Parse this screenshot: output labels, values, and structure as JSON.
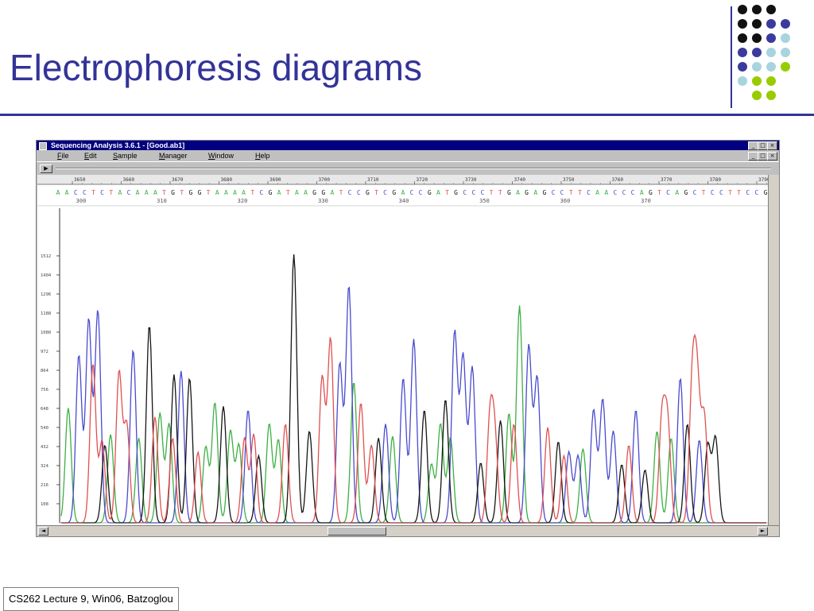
{
  "slide": {
    "title": "Electrophoresis diagrams",
    "footer": "CS262 Lecture 9, Win06, Batzoglou",
    "accent_color": "#333399",
    "dot_colors": {
      "black": "#111111",
      "purple": "#3b3b9e",
      "lightblue": "#a8d4e0",
      "green": "#99cc00"
    },
    "dot_grid": [
      [
        "black",
        "black",
        "black",
        null
      ],
      [
        "black",
        "black",
        "purple",
        "purple"
      ],
      [
        "black",
        "black",
        "purple",
        "lightblue"
      ],
      [
        "purple",
        "purple",
        "lightblue",
        "lightblue"
      ],
      [
        "purple",
        "lightblue",
        "lightblue",
        "green"
      ],
      [
        "lightblue",
        "green",
        "green",
        null
      ],
      [
        null,
        "green",
        "green",
        null
      ]
    ]
  },
  "app": {
    "window_title": "Sequencing Analysis 3.6.1 - [Good.ab1]",
    "menu": [
      "File",
      "Edit",
      "Sample",
      "Manager",
      "Window",
      "Help"
    ],
    "title_buttons": {
      "minimize": "_",
      "maximize": "□",
      "close": "×"
    },
    "tool_button": "▶",
    "scroll_left": "◄",
    "scroll_right": "►"
  },
  "chart_data": {
    "type": "line",
    "title": "",
    "xlabel": "",
    "ylabel": "",
    "sequence": "AACCTCTACAAATGTGGTAAAATCGATAAGGATCCGTCGACCGATGCCCTTGAGAGCCTTCAACCCAGTCAGCTCCTTCCG",
    "base_positions": [
      "300",
      "310",
      "320",
      "330",
      "340",
      "350",
      "360",
      "370"
    ],
    "scan_numbers": [
      "3650",
      "3660",
      "3670",
      "3680",
      "3690",
      "3700",
      "3710",
      "3720",
      "3730",
      "3740",
      "3750",
      "3760",
      "3770",
      "3780",
      "3790"
    ],
    "y_ticks": [
      "1512",
      "1404",
      "1296",
      "1188",
      "1080",
      "972",
      "864",
      "756",
      "648",
      "540",
      "432",
      "324",
      "216",
      "108"
    ],
    "ylim": [
      0,
      1620
    ],
    "series": [
      {
        "name": "A",
        "color": "#3cb043",
        "peaks": [
          {
            "x": 1.0,
            "h": 650
          },
          {
            "x": 7.0,
            "h": 500
          },
          {
            "x": 11.0,
            "h": 480
          },
          {
            "x": 14.0,
            "h": 620
          },
          {
            "x": 15.3,
            "h": 560
          },
          {
            "x": 20.5,
            "h": 430
          },
          {
            "x": 21.8,
            "h": 680
          },
          {
            "x": 24.0,
            "h": 520
          },
          {
            "x": 25.2,
            "h": 440
          },
          {
            "x": 29.5,
            "h": 560
          },
          {
            "x": 30.8,
            "h": 470
          },
          {
            "x": 41.5,
            "h": 800
          },
          {
            "x": 47.0,
            "h": 490
          },
          {
            "x": 52.5,
            "h": 330
          },
          {
            "x": 53.8,
            "h": 560
          },
          {
            "x": 55.2,
            "h": 480
          },
          {
            "x": 63.5,
            "h": 620
          },
          {
            "x": 65.0,
            "h": 1230
          },
          {
            "x": 74.0,
            "h": 420
          },
          {
            "x": 84.5,
            "h": 520
          },
          {
            "x": 86.5,
            "h": 480
          }
        ]
      },
      {
        "name": "C",
        "color": "#4a4ad0",
        "peaks": [
          {
            "x": 2.5,
            "h": 950
          },
          {
            "x": 3.9,
            "h": 1150
          },
          {
            "x": 5.2,
            "h": 1200
          },
          {
            "x": 10.2,
            "h": 980
          },
          {
            "x": 17.0,
            "h": 860
          },
          {
            "x": 26.5,
            "h": 640
          },
          {
            "x": 39.5,
            "h": 900
          },
          {
            "x": 40.8,
            "h": 1340
          },
          {
            "x": 46.0,
            "h": 560
          },
          {
            "x": 48.5,
            "h": 820
          },
          {
            "x": 50.0,
            "h": 1040
          },
          {
            "x": 55.8,
            "h": 1080
          },
          {
            "x": 57.0,
            "h": 940
          },
          {
            "x": 58.3,
            "h": 880
          },
          {
            "x": 66.3,
            "h": 1000
          },
          {
            "x": 67.5,
            "h": 820
          },
          {
            "x": 72.0,
            "h": 400
          },
          {
            "x": 73.3,
            "h": 380
          },
          {
            "x": 75.5,
            "h": 640
          },
          {
            "x": 76.8,
            "h": 700
          },
          {
            "x": 78.3,
            "h": 520
          },
          {
            "x": 81.5,
            "h": 640
          },
          {
            "x": 87.8,
            "h": 820
          },
          {
            "x": 90.5,
            "h": 470
          }
        ]
      },
      {
        "name": "G",
        "color": "#151515",
        "peaks": [
          {
            "x": 6.2,
            "h": 440
          },
          {
            "x": 12.5,
            "h": 1120
          },
          {
            "x": 16.0,
            "h": 840
          },
          {
            "x": 18.2,
            "h": 820
          },
          {
            "x": 23.0,
            "h": 660
          },
          {
            "x": 28.0,
            "h": 380
          },
          {
            "x": 33.0,
            "h": 1520
          },
          {
            "x": 35.2,
            "h": 520
          },
          {
            "x": 45.0,
            "h": 480
          },
          {
            "x": 51.5,
            "h": 640
          },
          {
            "x": 54.5,
            "h": 700
          },
          {
            "x": 59.5,
            "h": 340
          },
          {
            "x": 62.3,
            "h": 580
          },
          {
            "x": 70.5,
            "h": 460
          },
          {
            "x": 79.5,
            "h": 330
          },
          {
            "x": 82.8,
            "h": 300
          },
          {
            "x": 88.8,
            "h": 560
          },
          {
            "x": 91.7,
            "h": 440
          },
          {
            "x": 92.8,
            "h": 480
          }
        ]
      },
      {
        "name": "T",
        "color": "#e05050",
        "peaks": [
          {
            "x": 4.5,
            "h": 900
          },
          {
            "x": 5.8,
            "h": 460
          },
          {
            "x": 8.2,
            "h": 850
          },
          {
            "x": 9.3,
            "h": 550
          },
          {
            "x": 13.3,
            "h": 600
          },
          {
            "x": 15.8,
            "h": 480
          },
          {
            "x": 19.4,
            "h": 400
          },
          {
            "x": 26.0,
            "h": 480
          },
          {
            "x": 27.3,
            "h": 500
          },
          {
            "x": 31.8,
            "h": 560
          },
          {
            "x": 37.0,
            "h": 820
          },
          {
            "x": 38.2,
            "h": 1040
          },
          {
            "x": 42.5,
            "h": 680
          },
          {
            "x": 44.0,
            "h": 440
          },
          {
            "x": 60.8,
            "h": 560
          },
          {
            "x": 61.5,
            "h": 460
          },
          {
            "x": 64.2,
            "h": 560
          },
          {
            "x": 69.0,
            "h": 540
          },
          {
            "x": 71.3,
            "h": 380
          },
          {
            "x": 80.5,
            "h": 440
          },
          {
            "x": 85.2,
            "h": 580
          },
          {
            "x": 86.0,
            "h": 560
          },
          {
            "x": 89.5,
            "h": 760
          },
          {
            "x": 90.2,
            "h": 740
          },
          {
            "x": 91.2,
            "h": 600
          }
        ]
      }
    ],
    "grid": false,
    "legend": "none"
  }
}
